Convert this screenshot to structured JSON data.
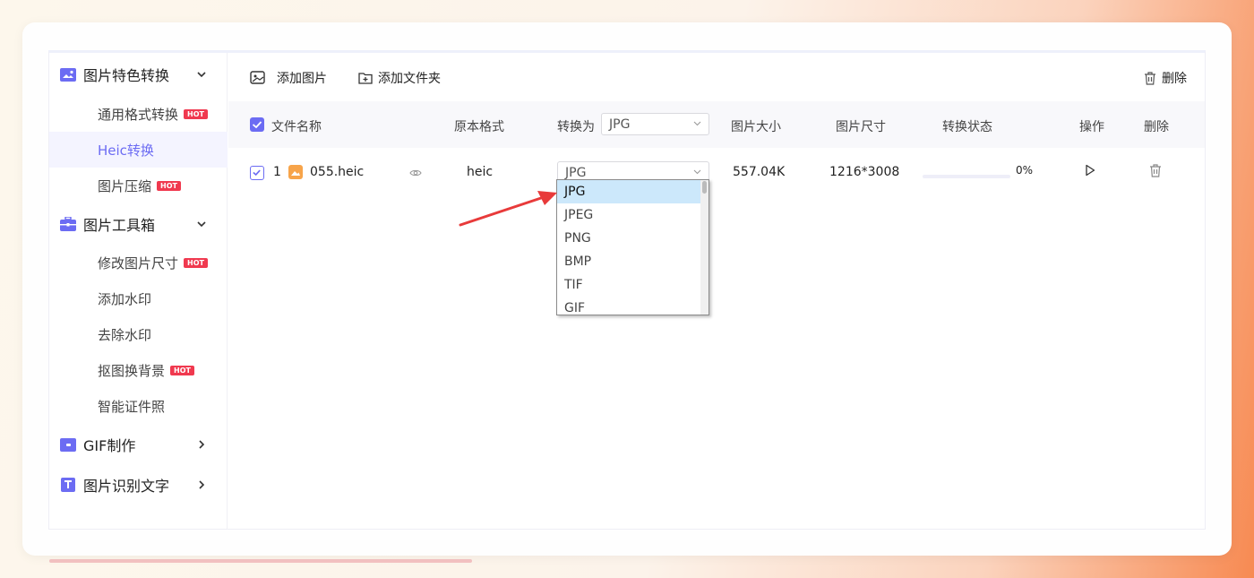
{
  "sidebar": {
    "groups": [
      {
        "label": "图片特色转换",
        "icon": "image-convert-icon",
        "expanded": true
      },
      {
        "label": "图片工具箱",
        "icon": "toolbox-icon",
        "expanded": true
      },
      {
        "label": "GIF制作",
        "icon": "gif-icon",
        "expanded": false
      },
      {
        "label": "图片识别文字",
        "icon": "text-recognition-icon",
        "expanded": false
      }
    ],
    "items": [
      {
        "label": "通用格式转换",
        "hot": "HOT"
      },
      {
        "label": "Heic转换",
        "active": true
      },
      {
        "label": "图片压缩",
        "hot": "HOT"
      },
      {
        "label": "修改图片尺寸",
        "hot": "HOT"
      },
      {
        "label": "添加水印"
      },
      {
        "label": "去除水印"
      },
      {
        "label": "抠图换背景",
        "hot": "HOT"
      },
      {
        "label": "智能证件照"
      }
    ]
  },
  "toolbar": {
    "add_image": "添加图片",
    "add_folder": "添加文件夹",
    "delete": "删除"
  },
  "table": {
    "headers": {
      "file_name": "文件名称",
      "original_format": "原本格式",
      "convert_to": "转换为",
      "convert_to_value": "JPG",
      "image_size": "图片大小",
      "dimensions": "图片尺寸",
      "status": "转换状态",
      "action": "操作",
      "delete": "删除"
    },
    "rows": [
      {
        "index": "1",
        "file_name": "055.heic",
        "original_format": "heic",
        "target_format": "JPG",
        "size": "557.04K",
        "dimensions": "1216*3008",
        "progress": 0,
        "progress_text": "0%"
      }
    ]
  },
  "dropdown": {
    "options": [
      "JPG",
      "JPEG",
      "PNG",
      "BMP",
      "TIF",
      "GIF"
    ],
    "selected": "JPG"
  },
  "colors": {
    "accent": "#6c6cf3",
    "hot_badge": "#f0394f",
    "annotation_arrow": "#e83a3a"
  }
}
